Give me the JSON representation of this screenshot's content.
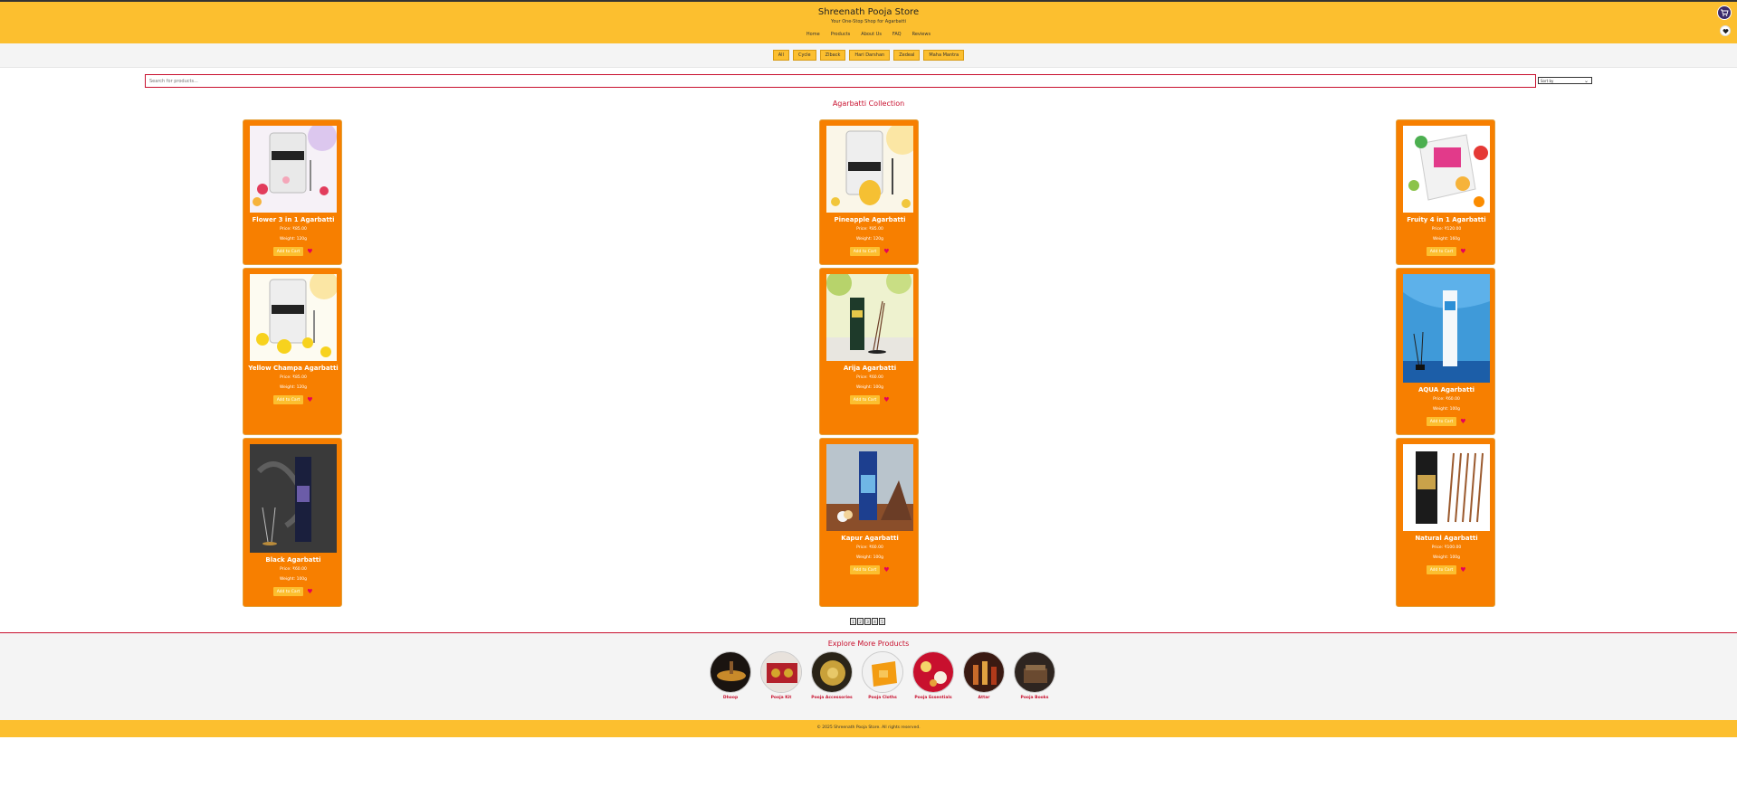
{
  "header": {
    "title": "Shreenath Pooja Store",
    "tagline": "Your One-Stop Shop for Agarbatti",
    "nav": [
      "Home",
      "Products",
      "About Us",
      "FAQ",
      "Reviews"
    ]
  },
  "icons": {
    "cart": "cart-icon",
    "wishlist": "heart-icon"
  },
  "filters": [
    "All",
    "Cycle",
    "Zlback",
    "Hari Darshan",
    "Zedeal",
    "Maha Mantra"
  ],
  "search": {
    "placeholder": "Search for products...",
    "sort_label": "Sort by"
  },
  "section_title": "Agarbatti Collection",
  "products": [
    {
      "name": "Flower 3 in 1 Agarbatti",
      "price": "Price: ₹85.00",
      "weight": "Weight: 120g",
      "add_label": "Add to Cart"
    },
    {
      "name": "Pineapple Agarbatti",
      "price": "Price: ₹85.00",
      "weight": "Weight: 120g",
      "add_label": "Add to Cart"
    },
    {
      "name": "Fruity 4 in 1 Agarbatti",
      "price": "Price: ₹120.00",
      "weight": "Weight: 160g",
      "add_label": "Add to Cart"
    },
    {
      "name": "Yellow Champa Agarbatti",
      "price": "Price: ₹85.00",
      "weight": "Weight: 120g",
      "add_label": "Add to Cart"
    },
    {
      "name": "Arija Agarbatti",
      "price": "Price: ₹60.00",
      "weight": "Weight: 100g",
      "add_label": "Add to Cart"
    },
    {
      "name": "AQUA Agarbatti",
      "price": "Price: ₹60.00",
      "weight": "Weight: 100g",
      "add_label": "Add to Cart"
    },
    {
      "name": "Black Agarbatti",
      "price": "Price: ₹60.00",
      "weight": "Weight: 100g",
      "add_label": "Add to Cart"
    },
    {
      "name": "Kapur Agarbatti",
      "price": "Price: ₹60.00",
      "weight": "Weight: 100g",
      "add_label": "Add to Cart"
    },
    {
      "name": "Natural Agarbatti",
      "price": "Price: ₹100.00",
      "weight": "Weight: 100g",
      "add_label": "Add to Cart"
    }
  ],
  "pagination": [
    "1",
    "2",
    "3",
    "4",
    "5"
  ],
  "explore": {
    "title": "Explore More Products",
    "categories": [
      "Dhoop",
      "Pooja Kit",
      "Pooja Accessories",
      "Pooja Cloths",
      "Pooja Essentials",
      "Attar",
      "Pooja Books"
    ]
  },
  "footer": {
    "copyright": "© 2025 Shreenath Pooja Store. All rights reserved."
  },
  "colors": {
    "brand_yellow": "#fcbf2f",
    "card_orange": "#f77f00",
    "accent_red": "#c8102e"
  }
}
